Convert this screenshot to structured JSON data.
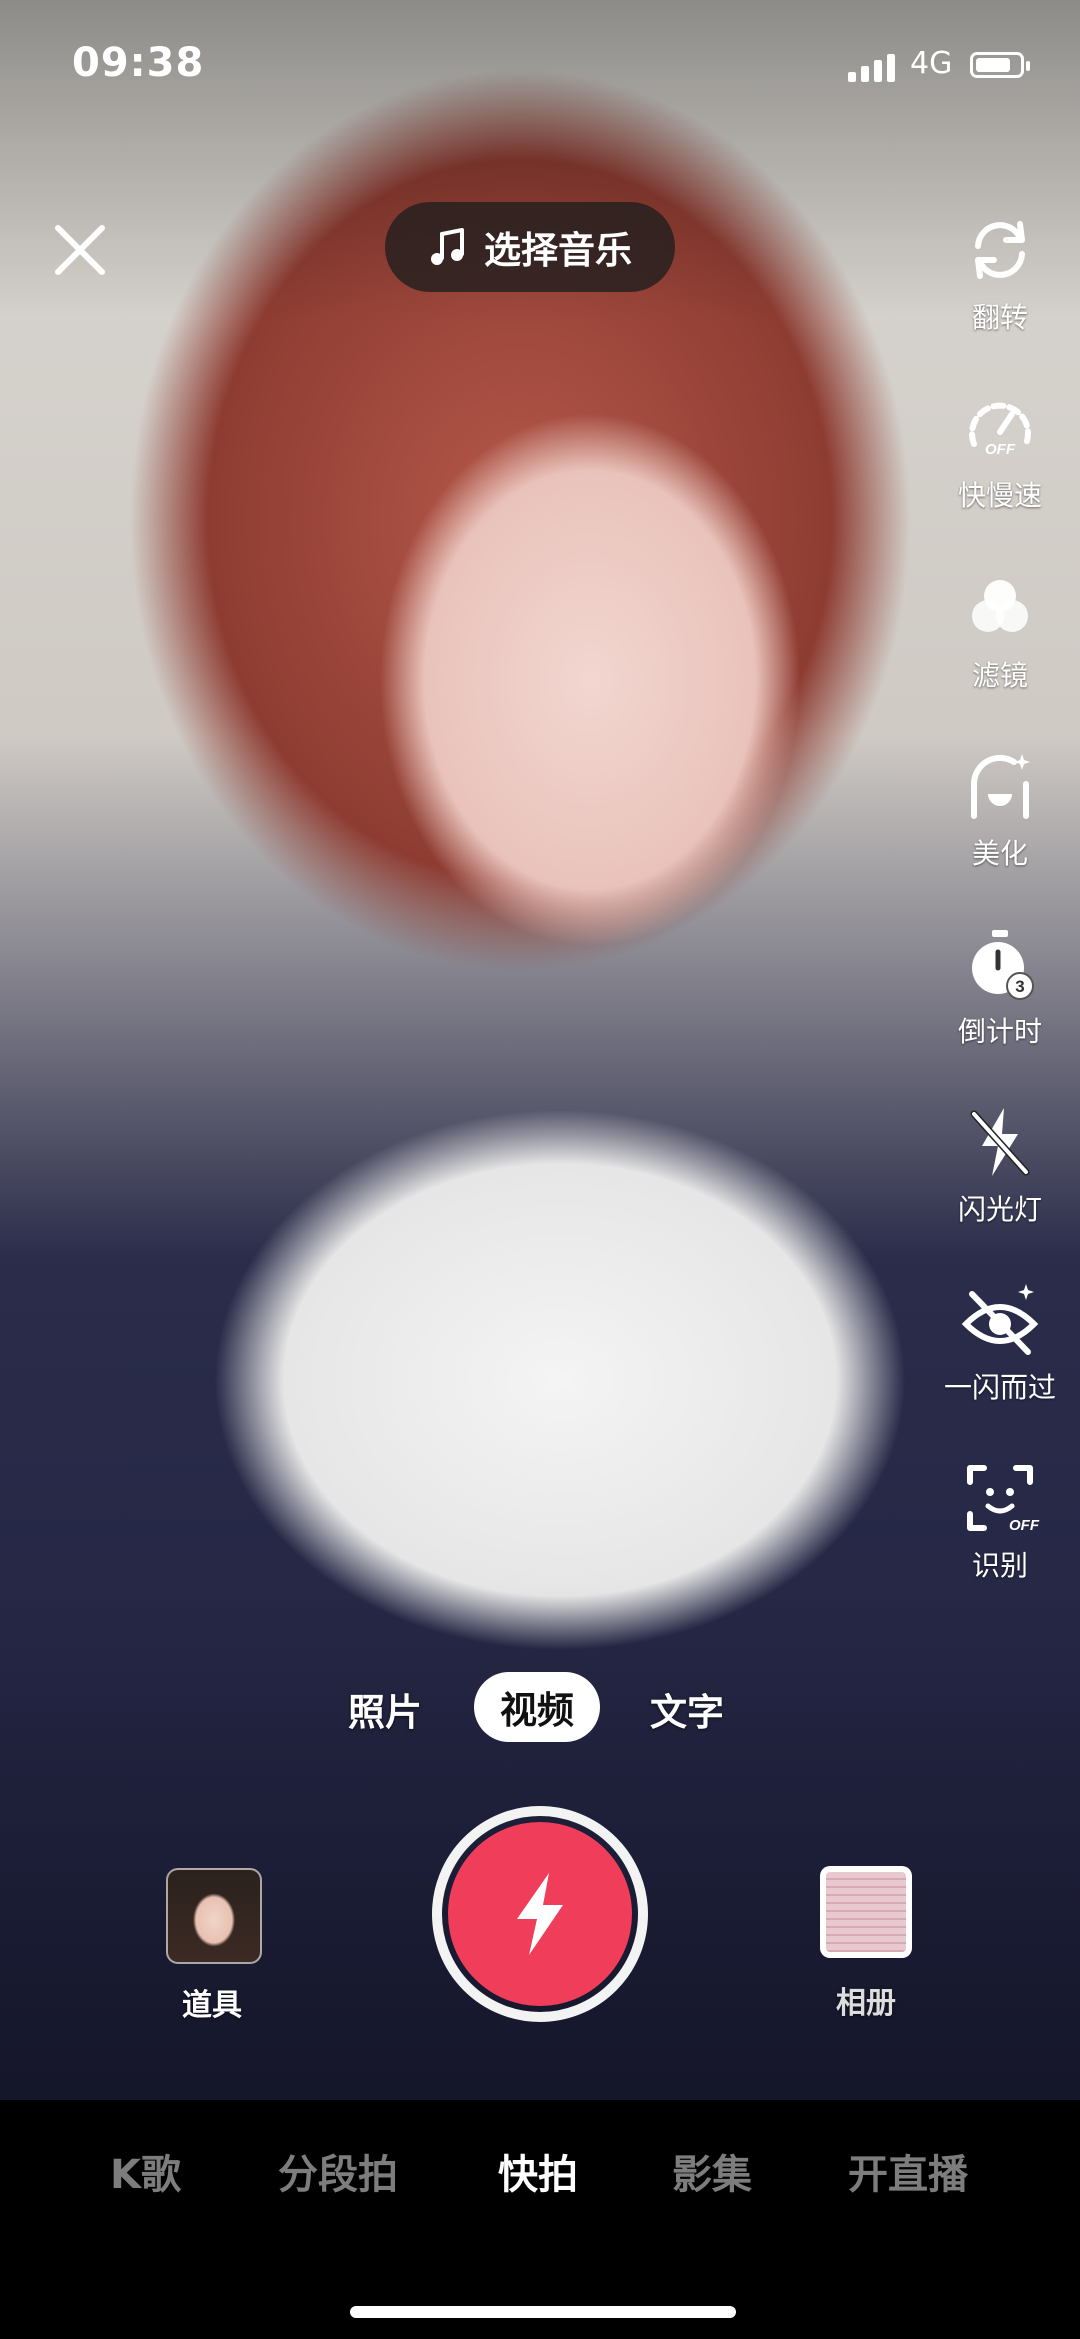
{
  "status_bar": {
    "time": "09:38",
    "network": "4G",
    "battery_level": 0.8
  },
  "top": {
    "music_label": "选择音乐"
  },
  "tools": [
    {
      "label": "翻转",
      "icon": "flip-camera-icon"
    },
    {
      "label": "快慢速",
      "icon": "speed-icon",
      "badge": "OFF"
    },
    {
      "label": "滤镜",
      "icon": "filter-icon"
    },
    {
      "label": "美化",
      "icon": "beautify-icon"
    },
    {
      "label": "倒计时",
      "icon": "timer-icon",
      "badge": "3"
    },
    {
      "label": "闪光灯",
      "icon": "flash-off-icon"
    },
    {
      "label": "一闪而过",
      "icon": "eye-flash-icon"
    },
    {
      "label": "识别",
      "icon": "face-recognition-icon",
      "badge": "OFF"
    }
  ],
  "modes": {
    "photo": "照片",
    "video": "视频",
    "text": "文字",
    "active": "视频"
  },
  "bottom": {
    "props_label": "道具",
    "album_label": "相册"
  },
  "tabs": [
    "K歌",
    "分段拍",
    "快拍",
    "影集",
    "开直播"
  ],
  "active_tab": "快拍",
  "colors": {
    "shutter": "#f03e5a",
    "tab_inactive": "#7d7d7d"
  }
}
